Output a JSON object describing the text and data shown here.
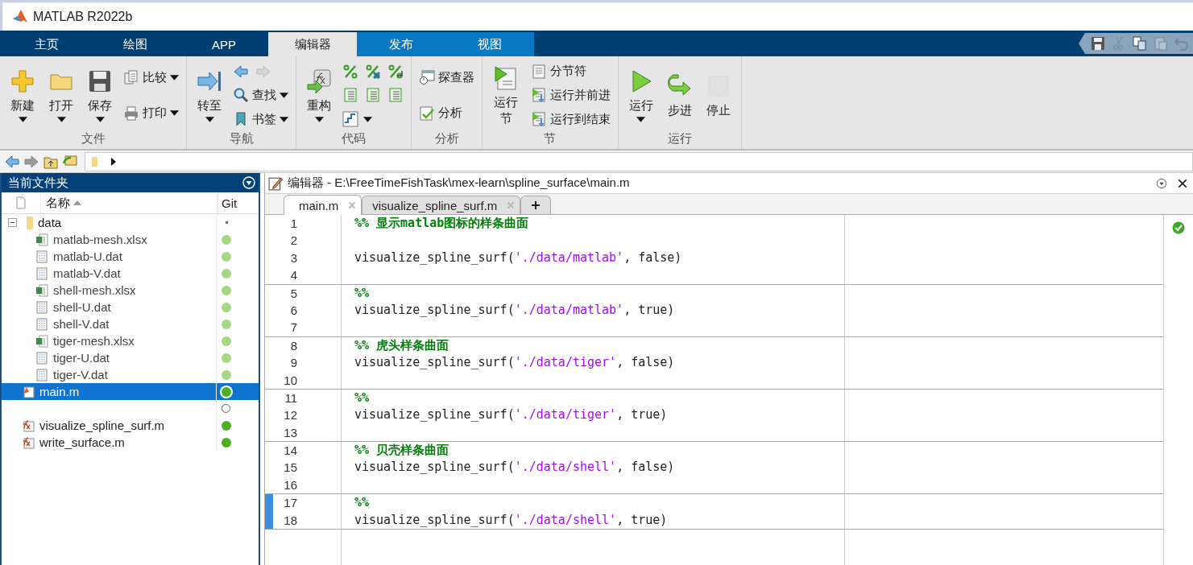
{
  "window": {
    "title": "MATLAB R2022b"
  },
  "ribbon_tabs": [
    {
      "label": "主页",
      "kind": "main",
      "selected": false
    },
    {
      "label": "绘图",
      "kind": "main",
      "selected": false
    },
    {
      "label": "APP",
      "kind": "main",
      "selected": false
    },
    {
      "label": "编辑器",
      "kind": "contextual",
      "selected": true
    },
    {
      "label": "发布",
      "kind": "contextual",
      "selected": false
    },
    {
      "label": "视图",
      "kind": "contextual",
      "selected": false
    }
  ],
  "ribbon_groups": [
    {
      "label": "文件",
      "columns": [
        [
          [
            {
              "kind": "large",
              "label": "新建",
              "dropdown": true,
              "disabled": false
            }
          ]
        ],
        [
          [
            {
              "kind": "large",
              "label": "打开",
              "dropdown": true,
              "disabled": false
            }
          ]
        ],
        [
          [
            {
              "kind": "large",
              "label": "保存",
              "dropdown": true,
              "disabled": false
            }
          ]
        ],
        [
          [
            {
              "kind": "small",
              "label": "比较",
              "dropdown": true,
              "disabled": false
            }
          ],
          [
            {
              "kind": "small",
              "label": "打印",
              "dropdown": true,
              "disabled": false
            }
          ]
        ]
      ]
    },
    {
      "label": "导航",
      "columns": [
        [
          [
            {
              "kind": "large",
              "label": "转至",
              "dropdown": true,
              "disabled": false
            }
          ]
        ],
        [
          [
            {
              "kind": "icon",
              "dropdown": false,
              "disabled": false
            },
            {
              "kind": "icon",
              "dropdown": false,
              "disabled": true
            }
          ],
          [
            {
              "kind": "small",
              "label": "查找",
              "dropdown": true,
              "disabled": false
            }
          ],
          [
            {
              "kind": "small",
              "label": "书签",
              "dropdown": true,
              "disabled": false
            }
          ]
        ]
      ]
    },
    {
      "label": "代码",
      "columns": [
        [
          [
            {
              "kind": "large",
              "label": "重构",
              "dropdown": true,
              "disabled": false
            }
          ]
        ],
        [
          [
            {
              "kind": "icon",
              "dropdown": false,
              "disabled": false
            },
            {
              "kind": "icon",
              "dropdown": false,
              "disabled": false
            },
            {
              "kind": "icon",
              "dropdown": false,
              "disabled": false
            }
          ],
          [
            {
              "kind": "icon",
              "dropdown": false,
              "disabled": false
            },
            {
              "kind": "icon",
              "dropdown": false,
              "disabled": false
            },
            {
              "kind": "icon",
              "dropdown": false,
              "disabled": false
            }
          ],
          [
            {
              "kind": "icon",
              "dropdown": true,
              "disabled": false
            }
          ]
        ]
      ]
    },
    {
      "label": "分析",
      "columns": [
        [
          [
            {
              "kind": "small",
              "label": "探查器",
              "dropdown": false,
              "disabled": false
            }
          ],
          [
            {
              "kind": "small",
              "label": "分析",
              "dropdown": false,
              "disabled": false
            }
          ]
        ]
      ]
    },
    {
      "label": "节",
      "columns": [
        [
          [
            {
              "kind": "large",
              "label": "运行节",
              "dropdown": false,
              "disabled": false
            }
          ]
        ],
        [
          [
            {
              "kind": "small",
              "label": "分节符",
              "dropdown": false,
              "disabled": false
            }
          ],
          [
            {
              "kind": "small",
              "label": "运行并前进",
              "dropdown": false,
              "disabled": false
            }
          ],
          [
            {
              "kind": "small",
              "label": "运行到结束",
              "dropdown": false,
              "disabled": false
            }
          ]
        ]
      ]
    },
    {
      "label": "运行",
      "columns": [
        [
          [
            {
              "kind": "large",
              "label": "运行",
              "dropdown": true,
              "disabled": false
            }
          ]
        ],
        [
          [
            {
              "kind": "large",
              "label": "步进",
              "dropdown": false,
              "disabled": false
            }
          ]
        ],
        [
          [
            {
              "kind": "large",
              "label": "停止",
              "dropdown": false,
              "disabled": true
            }
          ]
        ]
      ]
    }
  ],
  "quick_access": [
    {
      "disabled": false
    },
    {
      "disabled": true
    },
    {
      "disabled": false
    },
    {
      "disabled": true
    },
    {
      "disabled": true
    }
  ],
  "current_folder": {
    "title": "当前文件夹",
    "columns": [
      "名称",
      "Git"
    ],
    "items": [
      {
        "name": "data",
        "kind": "folder",
        "expanded": true,
        "selected": false,
        "git": {
          "kind": "tiny",
          "color": "#6b6bb0"
        },
        "children": [
          {
            "name": "matlab-mesh.xlsx",
            "kind": "excel",
            "selected": false,
            "git": {
              "kind": "dot",
              "color": "#a6d785"
            }
          },
          {
            "name": "matlab-U.dat",
            "kind": "dat",
            "selected": false,
            "git": {
              "kind": "dot",
              "color": "#a6d785"
            }
          },
          {
            "name": "matlab-V.dat",
            "kind": "dat",
            "selected": false,
            "git": {
              "kind": "dot",
              "color": "#a6d785"
            }
          },
          {
            "name": "shell-mesh.xlsx",
            "kind": "excel",
            "selected": false,
            "git": {
              "kind": "dot",
              "color": "#a6d785"
            }
          },
          {
            "name": "shell-U.dat",
            "kind": "dat",
            "selected": false,
            "git": {
              "kind": "dot",
              "color": "#a6d785"
            }
          },
          {
            "name": "shell-V.dat",
            "kind": "dat",
            "selected": false,
            "git": {
              "kind": "dot",
              "color": "#a6d785"
            }
          },
          {
            "name": "tiger-mesh.xlsx",
            "kind": "excel",
            "selected": false,
            "git": {
              "kind": "dot",
              "color": "#a6d785"
            }
          },
          {
            "name": "tiger-U.dat",
            "kind": "dat",
            "selected": false,
            "git": {
              "kind": "dot",
              "color": "#a6d785"
            }
          },
          {
            "name": "tiger-V.dat",
            "kind": "dat",
            "selected": false,
            "git": {
              "kind": "dot",
              "color": "#a6d785"
            }
          }
        ]
      },
      {
        "name": "main.m",
        "kind": "script",
        "selected": true,
        "git": {
          "kind": "dot",
          "color": "#4caf1f"
        }
      },
      {
        "kind": "blank",
        "selected": false,
        "git": {
          "kind": "ring",
          "color": "#666666"
        }
      },
      {
        "name": "visualize_spline_surf.m",
        "kind": "function",
        "selected": false,
        "git": {
          "kind": "dot",
          "color": "#4caf1f"
        }
      },
      {
        "name": "write_surface.m",
        "kind": "function",
        "selected": false,
        "git": {
          "kind": "dot",
          "color": "#4caf1f"
        }
      }
    ]
  },
  "editor": {
    "title": "编辑器 - E:\\FreeTimeFishTask\\mex-learn\\spline_surface\\main.m",
    "tabs": [
      {
        "label": "main.m",
        "selected": true
      },
      {
        "label": "visualize_spline_surf.m",
        "selected": false
      }
    ],
    "cells": [
      {
        "current": false,
        "lines": [
          {
            "number": "1",
            "segments": [
              {
                "kind": "comment",
                "text": "%% 显示matlab图标的样条曲面"
              }
            ]
          },
          {
            "number": "2"
          },
          {
            "number": "3",
            "segments": [
              {
                "kind": "plain",
                "text": "visualize_spline_surf("
              },
              {
                "kind": "string",
                "text": "'./data/matlab'"
              },
              {
                "kind": "plain",
                "text": ", false)"
              }
            ]
          },
          {
            "number": "4"
          }
        ]
      },
      {
        "current": false,
        "lines": [
          {
            "number": "5",
            "segments": [
              {
                "kind": "comment",
                "text": "%%"
              }
            ]
          },
          {
            "number": "6",
            "segments": [
              {
                "kind": "plain",
                "text": "visualize_spline_surf("
              },
              {
                "kind": "string",
                "text": "'./data/matlab'"
              },
              {
                "kind": "plain",
                "text": ", true)"
              }
            ]
          },
          {
            "number": "7"
          }
        ]
      },
      {
        "current": false,
        "lines": [
          {
            "number": "8",
            "segments": [
              {
                "kind": "comment",
                "text": "%% 虎头样条曲面"
              }
            ]
          },
          {
            "number": "9",
            "segments": [
              {
                "kind": "plain",
                "text": "visualize_spline_surf("
              },
              {
                "kind": "string",
                "text": "'./data/tiger'"
              },
              {
                "kind": "plain",
                "text": ", false)"
              }
            ]
          },
          {
            "number": "10"
          }
        ]
      },
      {
        "current": false,
        "lines": [
          {
            "number": "11",
            "segments": [
              {
                "kind": "comment",
                "text": "%%"
              }
            ]
          },
          {
            "number": "12",
            "segments": [
              {
                "kind": "plain",
                "text": "visualize_spline_surf("
              },
              {
                "kind": "string",
                "text": "'./data/tiger'"
              },
              {
                "kind": "plain",
                "text": ", true)"
              }
            ]
          },
          {
            "number": "13"
          }
        ]
      },
      {
        "current": false,
        "lines": [
          {
            "number": "14",
            "segments": [
              {
                "kind": "comment",
                "text": "%% 贝壳样条曲面"
              }
            ]
          },
          {
            "number": "15",
            "segments": [
              {
                "kind": "plain",
                "text": "visualize_spline_surf("
              },
              {
                "kind": "string",
                "text": "'./data/shell'"
              },
              {
                "kind": "plain",
                "text": ", false)"
              }
            ]
          },
          {
            "number": "16"
          }
        ]
      },
      {
        "current": true,
        "lines": [
          {
            "number": "17",
            "segments": [
              {
                "kind": "comment",
                "text": "%%"
              }
            ]
          },
          {
            "number": "18",
            "segments": [
              {
                "kind": "plain",
                "text": "visualize_spline_surf("
              },
              {
                "kind": "string",
                "text": "'./data/shell'"
              },
              {
                "kind": "plain",
                "text": ", true)"
              }
            ]
          }
        ]
      }
    ],
    "analysis_passed": true
  }
}
